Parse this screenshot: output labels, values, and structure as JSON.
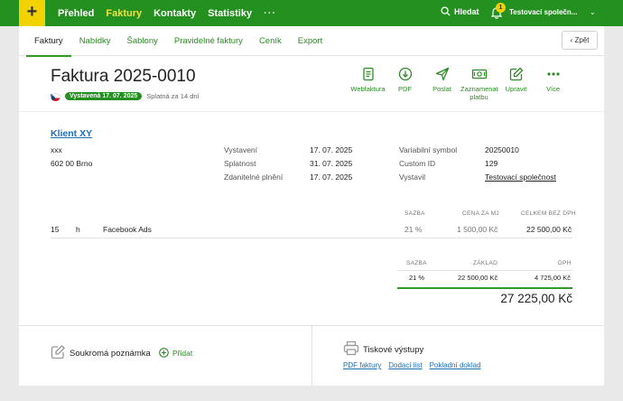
{
  "topbar": {
    "plus": "+",
    "nav": [
      {
        "label": "Přehled",
        "active": false
      },
      {
        "label": "Faktury",
        "active": true
      },
      {
        "label": "Kontakty",
        "active": false
      },
      {
        "label": "Statistiky",
        "active": false
      }
    ],
    "more": "···",
    "search_label": "Hledat",
    "notifications_count": "1",
    "company": "Testovací společn..."
  },
  "subnav": {
    "tabs": [
      {
        "label": "Faktury",
        "active": true
      },
      {
        "label": "Nabídky",
        "active": false
      },
      {
        "label": "Šablony",
        "active": false
      },
      {
        "label": "Pravidelné faktury",
        "active": false
      },
      {
        "label": "Ceník",
        "active": false
      },
      {
        "label": "Export",
        "active": false
      }
    ],
    "back_label": "Zpět"
  },
  "invoice": {
    "title": "Faktura 2025-0010",
    "status_badge": "Vystavená 17. 07. 2025",
    "due_text": "Splatná za 14 dní"
  },
  "actions": [
    {
      "label": "Webfaktura",
      "icon": "document-icon"
    },
    {
      "label": "PDF",
      "icon": "download-icon"
    },
    {
      "label": "Poslat",
      "icon": "send-icon"
    },
    {
      "label": "Zaznamenat platbu",
      "icon": "payment-icon"
    },
    {
      "label": "Upravit",
      "icon": "edit-icon"
    },
    {
      "label": "Více",
      "icon": "more-icon"
    }
  ],
  "client": {
    "name": "Klient XY",
    "address_line1": "xxx",
    "address_line2": "602 00 Brno"
  },
  "dates": {
    "issued_label": "Vystavení",
    "issued": "17. 07. 2025",
    "due_label": "Splatnost",
    "due": "31. 07. 2025",
    "taxable_label": "Zdanitelné plnění",
    "taxable": "17. 07. 2025"
  },
  "details": {
    "vs_label": "Variabilní symbol",
    "vs": "20250010",
    "custom_label": "Custom ID",
    "custom": "129",
    "issuer_label": "Vystavil",
    "issuer": "Testovací společnost"
  },
  "items": {
    "headers": {
      "rate": "SAZBA",
      "unit_price": "CENA ZA MJ",
      "total": "CELKEM BEZ DPH"
    },
    "row": {
      "qty": "15",
      "unit": "h",
      "name": "Facebook Ads",
      "rate": "21 %",
      "unit_price": "1 500,00 Kč",
      "total": "22 500,00 Kč"
    }
  },
  "summary": {
    "headers": {
      "rate": "SAZBA",
      "base": "ZÁKLAD",
      "vat": "DPH"
    },
    "row": {
      "rate": "21 %",
      "base": "22 500,00 Kč",
      "vat": "4 725,00 Kč"
    },
    "total": "27 225,00 Kč"
  },
  "note": {
    "label": "Soukromá poznámka",
    "add_label": "Přidat"
  },
  "print": {
    "label": "Tiskové výstupy",
    "links": [
      "PDF faktury",
      "Dodací list",
      "Pokladní doklad"
    ]
  },
  "colors": {
    "brand": "#24901f",
    "accent": "#f2d300",
    "link": "#1f6fb5"
  }
}
